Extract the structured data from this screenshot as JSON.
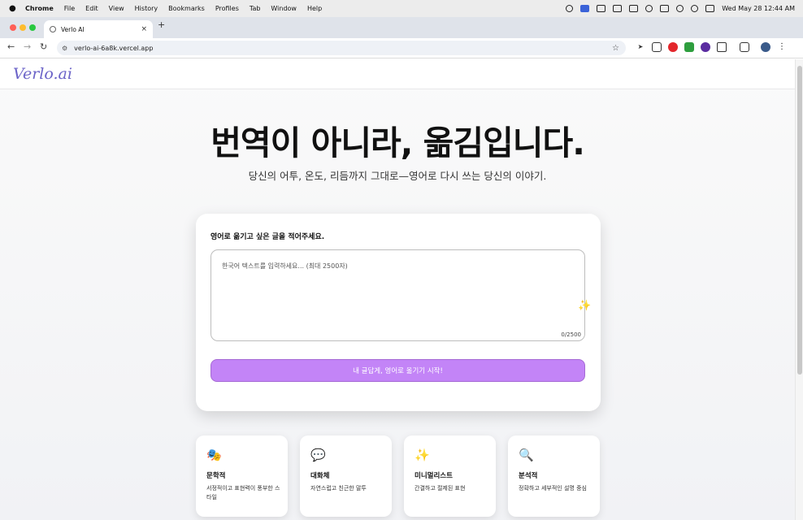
{
  "menubar": {
    "app": "Chrome",
    "items": [
      "File",
      "Edit",
      "View",
      "History",
      "Bookmarks",
      "Profiles",
      "Tab",
      "Window",
      "Help"
    ],
    "datetime": "Wed May 28  12:44 AM"
  },
  "browser": {
    "tab_title": "Verlo AI",
    "tab_close": "×",
    "new_tab": "+",
    "url": "verlo-ai-6a8k.vercel.app",
    "back": "←",
    "forward": "→",
    "reload": "↻",
    "bookmark_star": "☆",
    "menu": "⋮"
  },
  "site": {
    "logo": "Verlo.ai",
    "hero_title": "번역이 아니라, 옮김입니다.",
    "hero_subtitle": "당신의 어투, 온도, 리듬까지 그대로—영어로 다시 쓰는 당신의 이야기."
  },
  "composer": {
    "label": "영어로 옮기고 싶은 글을 적어주세요.",
    "placeholder": "한국어 텍스트를 입력하세요... (최대 2500자)",
    "value": "",
    "counter": "0/2500",
    "cta_label": "내 글답게, 영어로 옮기기 시작!"
  },
  "features": [
    {
      "icon": "🎭",
      "title": "문학적",
      "desc": "서정적이고 표현력이 풍부한 스타일"
    },
    {
      "icon": "💬",
      "title": "대화체",
      "desc": "자연스럽고 친근한 말투"
    },
    {
      "icon": "✨",
      "title": "미니멀리스트",
      "desc": "간결하고 절제된 표현"
    },
    {
      "icon": "🔍",
      "title": "분석적",
      "desc": "정확하고 세부적인 설명 중심"
    }
  ],
  "colors": {
    "cta": "#c384f7",
    "logo": "#6b63c8"
  }
}
